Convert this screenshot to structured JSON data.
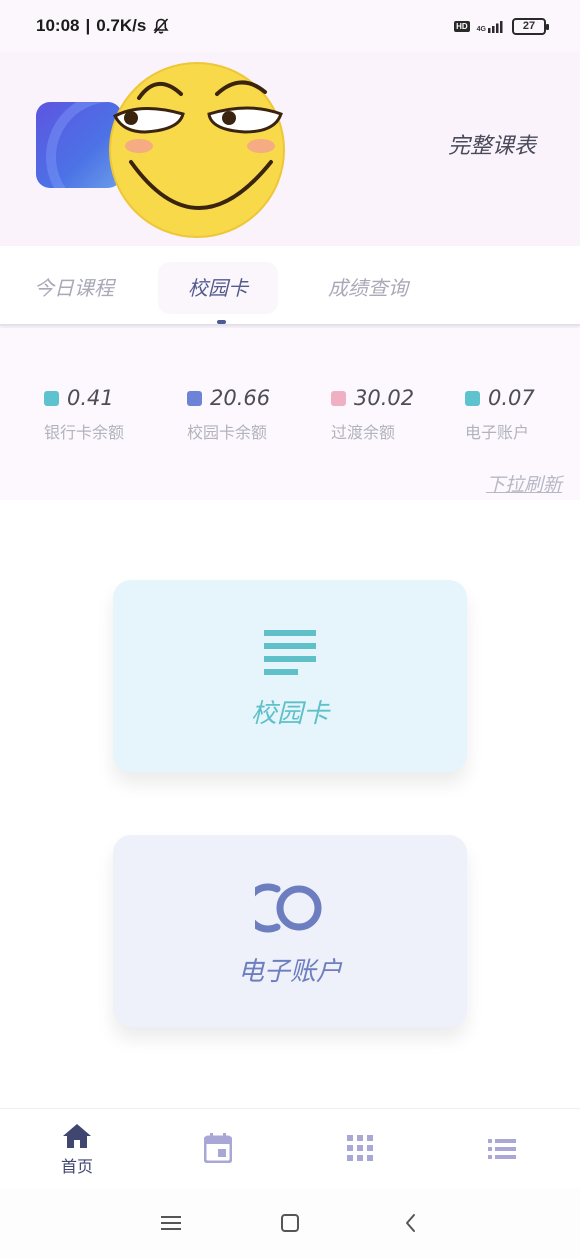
{
  "status_bar": {
    "time": "10:08",
    "separator": "|",
    "speed": "0.7K/s",
    "mute_icon": "bell-off-icon",
    "hd_badge": "HD",
    "network": "4G",
    "battery": "27"
  },
  "header": {
    "app_logo_icon": "app-logo",
    "avatar_icon": "smirk-emoji-avatar",
    "full_schedule": "完整课表"
  },
  "tabs": [
    {
      "label": "今日课程",
      "selected": false
    },
    {
      "label": "校园卡",
      "selected": true
    },
    {
      "label": "成绩查询",
      "selected": false
    }
  ],
  "balances": [
    {
      "value": "0.41",
      "label": "银行卡余额",
      "color": "#5ec3cf"
    },
    {
      "value": "20.66",
      "label": "校园卡余额",
      "color": "#6c83d6"
    },
    {
      "value": "30.02",
      "label": "过渡余额",
      "color": "#efb0c4"
    },
    {
      "value": "0.07",
      "label": "电子账户",
      "color": "#5ec3cf"
    }
  ],
  "refresh_hint": "下拉刷新",
  "cards": [
    {
      "label": "校园卡",
      "icon": "menu-lines-icon",
      "color": "#5fc0c9",
      "background": "#e6f5fb"
    },
    {
      "label": "电子账户",
      "icon": "double-circle-icon",
      "color": "#6c7ec0",
      "background": "#eef0fa"
    }
  ],
  "bottom_nav": [
    {
      "label": "首页",
      "icon": "home-icon",
      "active": true
    },
    {
      "label": "",
      "icon": "calendar-icon",
      "active": false
    },
    {
      "label": "",
      "icon": "grid-apps-icon",
      "active": false
    },
    {
      "label": "",
      "icon": "list-icon",
      "active": false
    }
  ],
  "system_nav": {
    "menu_icon": "menu-icon",
    "home_icon": "square-home-icon",
    "back_icon": "back-chevron-icon"
  },
  "colors": {
    "accent": "#4e5a96",
    "nav_active": "#3f4670",
    "nav_inactive": "#a9a7d6"
  }
}
